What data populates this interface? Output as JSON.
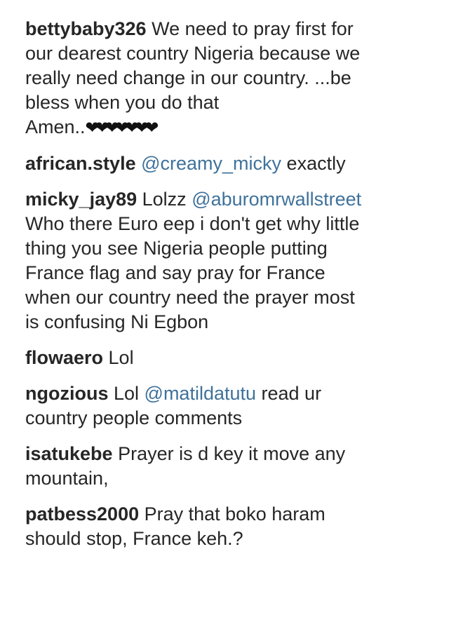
{
  "comments": [
    {
      "username": "bettybaby326",
      "lines": [
        "We need to pray first for",
        "our dearest country Nigeria because we",
        "really need change in our country. ...be",
        "bless when you do that",
        "Amen.."
      ],
      "emoji": "❤❤❤❤❤❤❤"
    },
    {
      "username": "african.style",
      "mention": "@creamy_micky",
      "text_after": " exactly"
    },
    {
      "username": "micky_jay89",
      "text_before": " Lolzz ",
      "mention": "@aburomrwallstreet",
      "lines": [
        "Who there Euro eep i don't get why little",
        "thing you see Nigeria people putting",
        "France flag and say pray for France",
        "when our country need the prayer most",
        "is confusing Ni Egbon"
      ]
    },
    {
      "username": "flowaero",
      "text": " Lol"
    },
    {
      "username": "ngozious",
      "text_before": " Lol ",
      "mention": "@matildatutu",
      "text_after": " read ur",
      "lines": [
        "country people comments"
      ]
    },
    {
      "username": "isatukebe",
      "text": " Prayer is d key it move any",
      "lines": [
        "mountain,"
      ]
    },
    {
      "username": "patbess2000",
      "text": " Pray that boko haram",
      "lines": [
        "should stop, France keh.?"
      ]
    }
  ]
}
